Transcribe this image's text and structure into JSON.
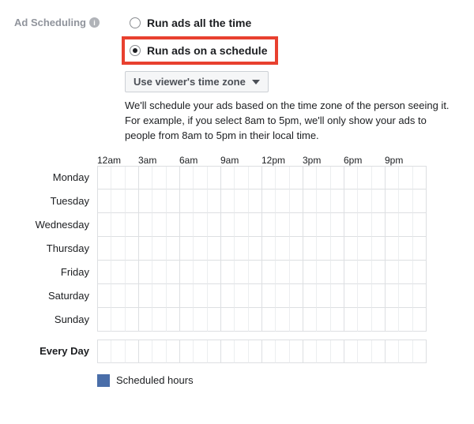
{
  "section_label": "Ad Scheduling",
  "radios": {
    "all_time": "Run ads all the time",
    "on_schedule": "Run ads on a schedule"
  },
  "timezone_dropdown": "Use viewer's time zone",
  "help_text_1": "We'll schedule your ads based on the time zone of the person seeing it.",
  "help_text_2": "For example, if you select 8am to 5pm, we'll only show your ads to people from 8am to 5pm in their local time.",
  "hours": [
    "12am",
    "3am",
    "6am",
    "9am",
    "12pm",
    "3pm",
    "6pm",
    "9pm"
  ],
  "days": [
    "Monday",
    "Tuesday",
    "Wednesday",
    "Thursday",
    "Friday",
    "Saturday",
    "Sunday"
  ],
  "every_day": "Every Day",
  "legend": "Scheduled hours"
}
